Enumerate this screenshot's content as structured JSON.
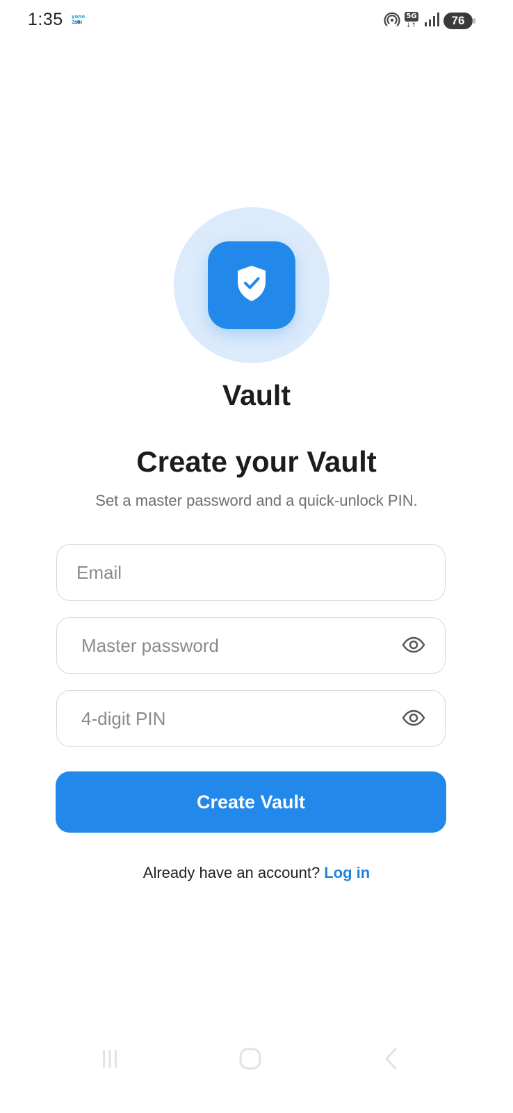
{
  "status_bar": {
    "time": "1:35",
    "notification_app_line1": "yono 2.0",
    "notification_app_line2": "SBI",
    "network_type": "5G",
    "network_arrows": "↓↑",
    "battery_level": "76",
    "icons": [
      "hotspot-icon",
      "network-5g-icon",
      "signal-bars-icon",
      "battery-icon"
    ]
  },
  "branding": {
    "app_name": "Vault",
    "logo_icon": "shield-check-icon",
    "accent_color": "#2288ea",
    "halo_color": "#dcebfb"
  },
  "header": {
    "title": "Create your Vault",
    "subtitle": "Set a master password and a quick-unlock PIN."
  },
  "form": {
    "email": {
      "placeholder": "Email",
      "value": ""
    },
    "master_password": {
      "placeholder": "Master password",
      "value": "",
      "toggle_icon": "eye-icon"
    },
    "pin": {
      "placeholder": "4-digit PIN",
      "value": "",
      "toggle_icon": "eye-icon"
    },
    "submit_label": "Create Vault"
  },
  "footer": {
    "prompt": "Already have an account?",
    "link_label": "Log in"
  },
  "nav_bar": {
    "icons": [
      "recent-apps-icon",
      "home-icon",
      "back-icon"
    ]
  }
}
